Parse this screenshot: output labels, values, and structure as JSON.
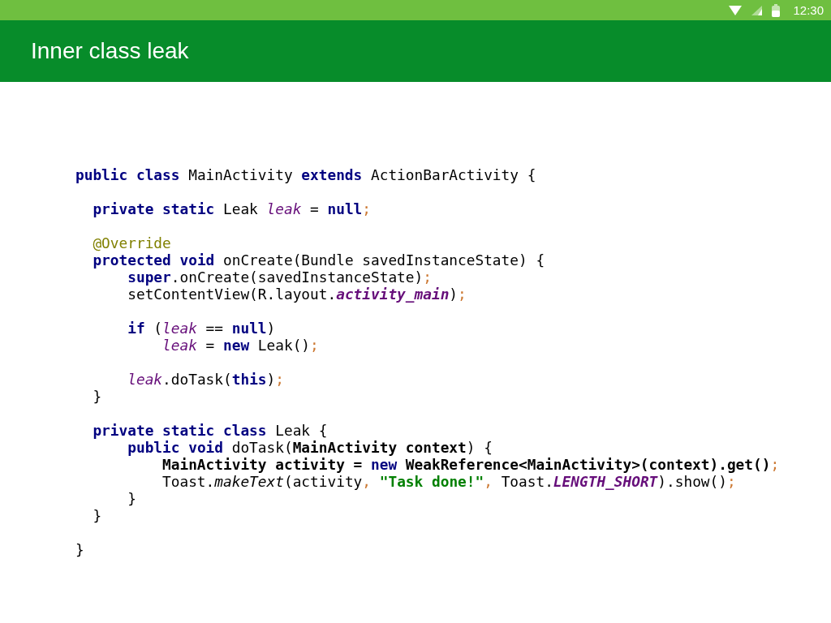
{
  "status_bar": {
    "time": "12:30"
  },
  "app_bar": {
    "title": "Inner class leak"
  },
  "code_blocks": [
    [
      [
        {
          "kind": "kw",
          "text": "public "
        },
        {
          "kind": "kw",
          "text": "class"
        },
        {
          "kind": "plain",
          "text": " MainActivity "
        },
        {
          "kind": "kw",
          "text": "extends"
        },
        {
          "kind": "plain",
          "text": " ActionBarActivity {"
        }
      ]
    ],
    [
      [
        {
          "kind": "kw",
          "text": "  private "
        },
        {
          "kind": "kw",
          "text": "static"
        },
        {
          "kind": "plain",
          "text": " Leak "
        },
        {
          "kind": "field",
          "text": "leak"
        },
        {
          "kind": "plain",
          "text": " = "
        },
        {
          "kind": "kw",
          "text": "null"
        },
        {
          "kind": "punct",
          "text": ";"
        }
      ]
    ],
    [
      [
        {
          "kind": "annotation",
          "text": "  @Override"
        }
      ],
      [
        {
          "kind": "kw",
          "text": "  protected "
        },
        {
          "kind": "kw",
          "text": "void"
        },
        {
          "kind": "plain",
          "text": " onCreate(Bundle savedInstanceState) {"
        }
      ],
      [
        {
          "kind": "kw",
          "text": "      super"
        },
        {
          "kind": "plain",
          "text": ".onCreate(savedInstanceState)"
        },
        {
          "kind": "punct",
          "text": ";"
        }
      ],
      [
        {
          "kind": "plain",
          "text": "      setContentView(R.layout."
        },
        {
          "kind": "constant",
          "text": "activity_main"
        },
        {
          "kind": "plain",
          "text": ")"
        },
        {
          "kind": "punct",
          "text": ";"
        }
      ]
    ],
    [
      [
        {
          "kind": "kw",
          "text": "      if"
        },
        {
          "kind": "plain",
          "text": " ("
        },
        {
          "kind": "field",
          "text": "leak"
        },
        {
          "kind": "plain",
          "text": " == "
        },
        {
          "kind": "kw",
          "text": "null"
        },
        {
          "kind": "plain",
          "text": ")"
        }
      ],
      [
        {
          "kind": "field",
          "text": "          leak"
        },
        {
          "kind": "plain",
          "text": " = "
        },
        {
          "kind": "kw",
          "text": "new"
        },
        {
          "kind": "plain",
          "text": " Leak()"
        },
        {
          "kind": "punct",
          "text": ";"
        }
      ]
    ],
    [
      [
        {
          "kind": "field",
          "text": "      leak"
        },
        {
          "kind": "plain",
          "text": ".doTask("
        },
        {
          "kind": "kw",
          "text": "this"
        },
        {
          "kind": "plain",
          "text": ")"
        },
        {
          "kind": "punct",
          "text": ";"
        }
      ],
      [
        {
          "kind": "plain",
          "text": "  }"
        }
      ]
    ],
    [
      [
        {
          "kind": "kw",
          "text": "  private "
        },
        {
          "kind": "kw",
          "text": "static "
        },
        {
          "kind": "kw",
          "text": "class"
        },
        {
          "kind": "plain",
          "text": " Leak {"
        }
      ],
      [
        {
          "kind": "kw",
          "text": "      public "
        },
        {
          "kind": "kw",
          "text": "void"
        },
        {
          "kind": "plain",
          "text": " doTask("
        },
        {
          "kind": "bold",
          "text": "MainActivity context"
        },
        {
          "kind": "plain",
          "text": ") {"
        }
      ],
      [
        {
          "kind": "bold",
          "text": "          MainActivity activity = "
        },
        {
          "kind": "kw",
          "text": "new"
        },
        {
          "kind": "bold",
          "text": " WeakReference<MainActivity>(context).get()"
        },
        {
          "kind": "punct",
          "text": ";"
        }
      ],
      [
        {
          "kind": "plain",
          "text": "          Toast."
        },
        {
          "kind": "method",
          "text": "makeText"
        },
        {
          "kind": "plain",
          "text": "(activity"
        },
        {
          "kind": "punct",
          "text": ", "
        },
        {
          "kind": "string",
          "text": "\"Task done!\""
        },
        {
          "kind": "punct",
          "text": ", "
        },
        {
          "kind": "plain",
          "text": "Toast."
        },
        {
          "kind": "constant",
          "text": "LENGTH_SHORT"
        },
        {
          "kind": "plain",
          "text": ").show()"
        },
        {
          "kind": "punct",
          "text": ";"
        }
      ],
      [
        {
          "kind": "plain",
          "text": "      }"
        }
      ],
      [
        {
          "kind": "plain",
          "text": "  }"
        }
      ]
    ],
    [
      [
        {
          "kind": "plain",
          "text": "}"
        }
      ]
    ]
  ]
}
